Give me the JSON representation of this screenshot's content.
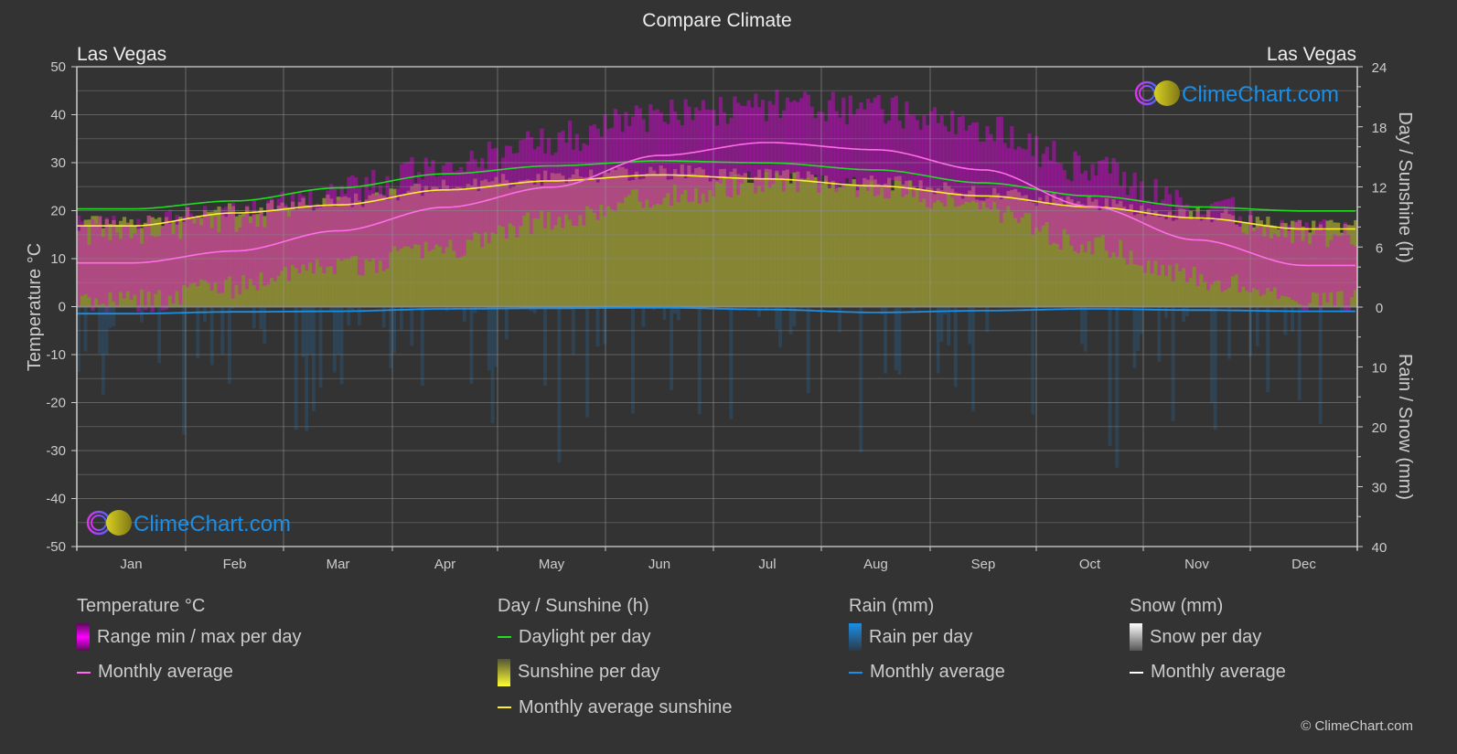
{
  "title": "Compare Climate",
  "location_left": "Las Vegas",
  "location_right": "Las Vegas",
  "watermark": "ClimeChart.com",
  "copyright": "© ClimeChart.com",
  "colors": {
    "background": "#333333",
    "temp_range": "#e000e0",
    "temp_avg": "#ff6ee8",
    "daylight": "#22dd22",
    "sunshine_fill": "#8a8a35",
    "sunshine_avg": "#ffee33",
    "rain": "#1a8fe8",
    "snow_avg": "#ffffff",
    "logo_text": "#1a8fe8"
  },
  "legend": {
    "temperature": {
      "title": "Temperature °C",
      "items": [
        {
          "label": "Range min / max per day",
          "type": "box"
        },
        {
          "label": "Monthly average",
          "type": "line"
        }
      ]
    },
    "sunshine": {
      "title": "Day / Sunshine (h)",
      "items": [
        {
          "label": "Daylight per day",
          "type": "line"
        },
        {
          "label": "Sunshine per day",
          "type": "box"
        },
        {
          "label": "Monthly average sunshine",
          "type": "line"
        }
      ]
    },
    "rain": {
      "title": "Rain (mm)",
      "items": [
        {
          "label": "Rain per day",
          "type": "box"
        },
        {
          "label": "Monthly average",
          "type": "line"
        }
      ]
    },
    "snow": {
      "title": "Snow (mm)",
      "items": [
        {
          "label": "Snow per day",
          "type": "box"
        },
        {
          "label": "Monthly average",
          "type": "line"
        }
      ]
    }
  },
  "chart_data": {
    "type": "line",
    "title": "Compare Climate",
    "categories": [
      "Jan",
      "Feb",
      "Mar",
      "Apr",
      "May",
      "Jun",
      "Jul",
      "Aug",
      "Sep",
      "Oct",
      "Nov",
      "Dec"
    ],
    "axes": {
      "left": {
        "label": "Temperature °C",
        "range": [
          -50,
          50
        ],
        "ticks": [
          50,
          40,
          30,
          20,
          10,
          0,
          -10,
          -20,
          -30,
          -40,
          -50
        ]
      },
      "right_top": {
        "label": "Day / Sunshine (h)",
        "range": [
          0,
          24
        ],
        "ticks": [
          24,
          18,
          12,
          6,
          0
        ]
      },
      "right_bottom": {
        "label": "Rain / Snow (mm)",
        "range": [
          0,
          40
        ],
        "ticks": [
          10,
          20,
          30,
          40
        ]
      }
    },
    "grid": true,
    "series": [
      {
        "name": "Temperature monthly average (°C)",
        "axis": "left",
        "values": [
          9.1,
          11.6,
          15.8,
          20.7,
          24.9,
          31.5,
          34.2,
          32.7,
          28.5,
          20.9,
          13.9,
          8.6
        ]
      },
      {
        "name": "Temperature daily max (approx, °C)",
        "axis": "left",
        "values": [
          16,
          19,
          24,
          29,
          35,
          40,
          42,
          41,
          37,
          29,
          21,
          15
        ]
      },
      {
        "name": "Temperature daily min (approx, °C)",
        "axis": "left",
        "values": [
          1,
          4,
          8,
          12,
          18,
          23,
          26,
          25,
          20,
          13,
          6,
          1
        ]
      },
      {
        "name": "Daylight per day (h)",
        "axis": "right_top",
        "values": [
          9.8,
          10.6,
          11.9,
          13.3,
          14.1,
          14.6,
          14.4,
          13.7,
          12.4,
          11.1,
          10.0,
          9.6
        ]
      },
      {
        "name": "Monthly average sunshine (h)",
        "axis": "right_top",
        "values": [
          8.1,
          9.4,
          10.2,
          11.7,
          12.6,
          13.2,
          12.8,
          12.1,
          11.1,
          10.0,
          8.9,
          7.8
        ]
      },
      {
        "name": "Rain monthly average (mm)",
        "axis": "right_bottom",
        "values": [
          1.1,
          0.8,
          0.7,
          0.3,
          0.2,
          0.1,
          0.4,
          0.9,
          0.6,
          0.3,
          0.5,
          0.7
        ]
      },
      {
        "name": "Snow monthly average (mm)",
        "axis": "right_bottom",
        "values": [
          0,
          0,
          0,
          0,
          0,
          0,
          0,
          0,
          0,
          0,
          0,
          0
        ]
      }
    ]
  }
}
